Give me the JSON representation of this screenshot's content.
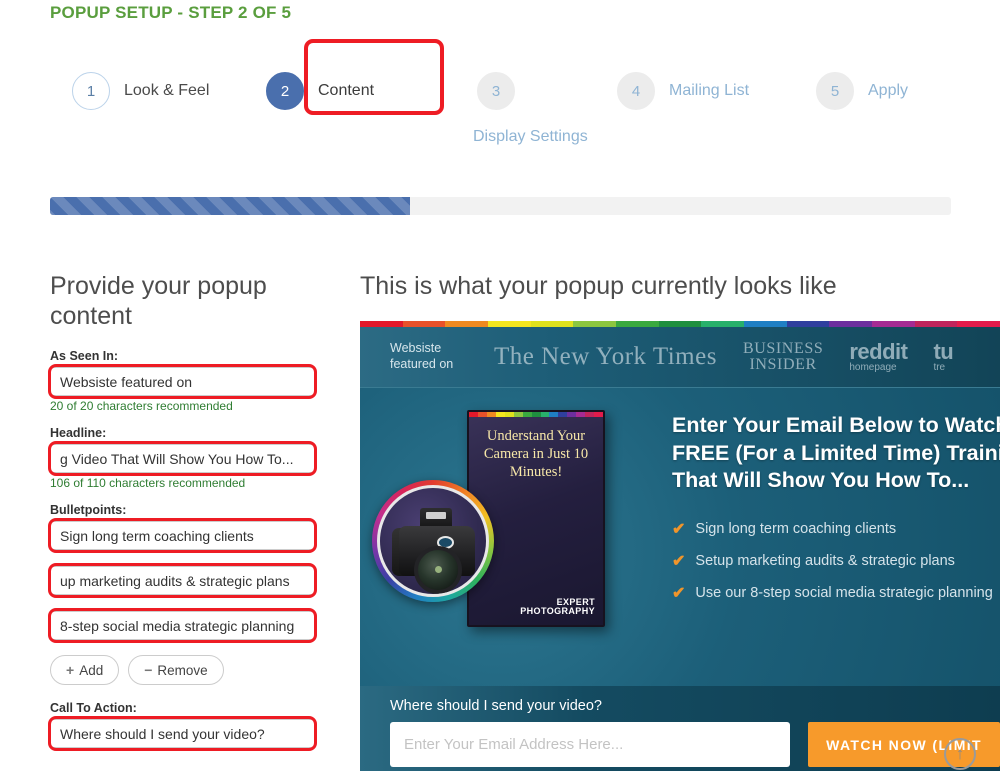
{
  "header": {
    "title": "POPUP SETUP - STEP 2 OF 5",
    "accent": "#5a9e3e"
  },
  "wizard": {
    "highlight_color": "#ee1c24",
    "steps": [
      {
        "num": "1",
        "label": "Look & Feel",
        "state": "done"
      },
      {
        "num": "2",
        "label": "Content",
        "state": "active"
      },
      {
        "num": "3",
        "label": "Display Settings",
        "state": "todo"
      },
      {
        "num": "4",
        "label": "Mailing List",
        "state": "todo"
      },
      {
        "num": "5",
        "label": "Apply",
        "state": "todo"
      }
    ]
  },
  "progress": {
    "percent": 40,
    "fill_color": "#4a6fad",
    "track_color": "#f2f2f2"
  },
  "form": {
    "heading": "Provide your popup content",
    "as_seen_in": {
      "label": "As Seen In:",
      "value": "Websiste featured on",
      "counter": "20 of 20 characters recommended"
    },
    "headline": {
      "label": "Headline:",
      "value": "g Video That Will Show You How To...",
      "counter": "106 of 110 characters recommended"
    },
    "bulletpoints": {
      "label": "Bulletpoints:",
      "items": [
        "Sign long term coaching clients",
        "up marketing audits & strategic plans",
        "8-step social media strategic planning"
      ]
    },
    "buttons": {
      "add": "Add",
      "remove": "Remove",
      "add_glyph": "+",
      "remove_glyph": "−"
    },
    "call_to_action": {
      "label": "Call To Action:",
      "value": "Where should I send your video?"
    }
  },
  "preview": {
    "heading": "This is what your popup currently looks like",
    "rainbow": [
      "#e3182a",
      "#e8512a",
      "#ef8a21",
      "#f4e61f",
      "#dfe21d",
      "#8cc63f",
      "#3aa93f",
      "#1f8f3f",
      "#28b06b",
      "#1f7fc4",
      "#2f3f9e",
      "#6c2f9e",
      "#a52b93",
      "#c0245c",
      "#e31b4b"
    ],
    "as_seen_in_line1": "Websiste",
    "as_seen_in_line2": "featured on",
    "logos": [
      {
        "name": "nyt",
        "text": "The New York Times"
      },
      {
        "name": "business-insider",
        "line1": "BUSINESS",
        "line2": "INSIDER"
      },
      {
        "name": "reddit",
        "text": "reddit",
        "sub": "homepage"
      },
      {
        "name": "twitter-trending",
        "text": "tu",
        "sub": "tre"
      }
    ],
    "product": {
      "dvd_title": "Understand Your Camera in Just 10 Minutes!",
      "brand_line1": "EXPERT",
      "brand_line2": "PHOTOGRAPHY"
    },
    "headline": "Enter Your Email Below to Watch FREE (For a Limited Time) Training That Will Show You How To...",
    "headline_lines": [
      "Enter Your Email Below to Watch",
      "FREE (For a Limited Time) Traini",
      "That Will Show You How To..."
    ],
    "bullets": [
      "Sign long term coaching clients",
      "Setup marketing audits & strategic plans",
      "Use our 8-step social media strategic planning"
    ],
    "check_glyph": "✔",
    "cta_label": "Where should I send your video?",
    "email_placeholder": "Enter Your Email Address Here...",
    "cta_button": "WATCH NOW (LIMIT",
    "cta_button_color": "#f79a2b"
  },
  "scroll_top": {
    "glyph": "↑"
  }
}
